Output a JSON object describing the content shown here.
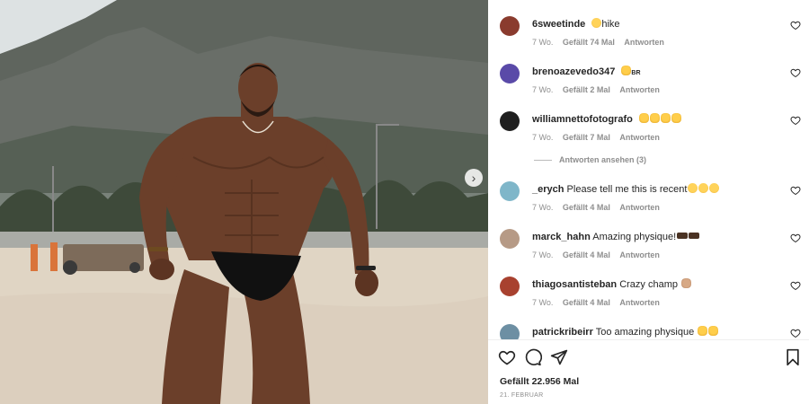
{
  "post": {
    "next_icon": "chevron-right-icon",
    "likes_text": "Gefällt 22.956 Mal",
    "date_text": "21. FEBRUAR"
  },
  "comments": [
    {
      "user": "6sweetinde",
      "text": "hike",
      "emoji": "laughing-emoji",
      "meta_age": "7 Wo.",
      "meta_likes": "Gefällt 74 Mal",
      "meta_reply": "Antworten",
      "avatar_color": "#8a3b2e"
    },
    {
      "user": "brenoazevedo347",
      "text": "BR",
      "emoji": "clap-emoji",
      "meta_age": "7 Wo.",
      "meta_likes": "Gefällt 2 Mal",
      "meta_reply": "Antworten",
      "avatar_color": "#5a4aa8"
    },
    {
      "user": "williamnettofotografo",
      "text": "",
      "emoji": "clap-emoji x4",
      "meta_age": "7 Wo.",
      "meta_likes": "Gefällt 7 Mal",
      "meta_reply": "Antworten",
      "avatar_color": "#1f1f1f"
    },
    {
      "user": "_erych",
      "text": "Please tell me this is recent",
      "emoji": "laughing-emoji x3",
      "meta_age": "7 Wo.",
      "meta_likes": "Gefällt 4 Mal",
      "meta_reply": "Antworten",
      "avatar_color": "#7fb6c9"
    },
    {
      "user": "marck_hahn",
      "text": "Amazing physique!",
      "emoji": "dark-hands-emoji x2",
      "meta_age": "7 Wo.",
      "meta_likes": "Gefällt 4 Mal",
      "meta_reply": "Antworten",
      "avatar_color": "#b69a86"
    },
    {
      "user": "thiagosantisteban",
      "text": "Crazy champ",
      "emoji": "muscle-emoji",
      "meta_age": "7 Wo.",
      "meta_likes": "Gefällt 4 Mal",
      "meta_reply": "Antworten",
      "avatar_color": "#a8412f"
    },
    {
      "user": "patrickribeirr",
      "text": "Too amazing physique",
      "emoji": "clap-emoji x2",
      "meta_age": "",
      "meta_likes": "",
      "meta_reply": "",
      "avatar_color": "#6d8fa3"
    }
  ],
  "view_replies": "Antworten ansehen (3)",
  "actions": {
    "like_icon": "heart-icon",
    "comment_icon": "comment-icon",
    "share_icon": "send-icon",
    "save_icon": "bookmark-icon"
  },
  "colors": {
    "text": "#262626",
    "muted": "#8e8e8e",
    "border": "#efefef"
  }
}
